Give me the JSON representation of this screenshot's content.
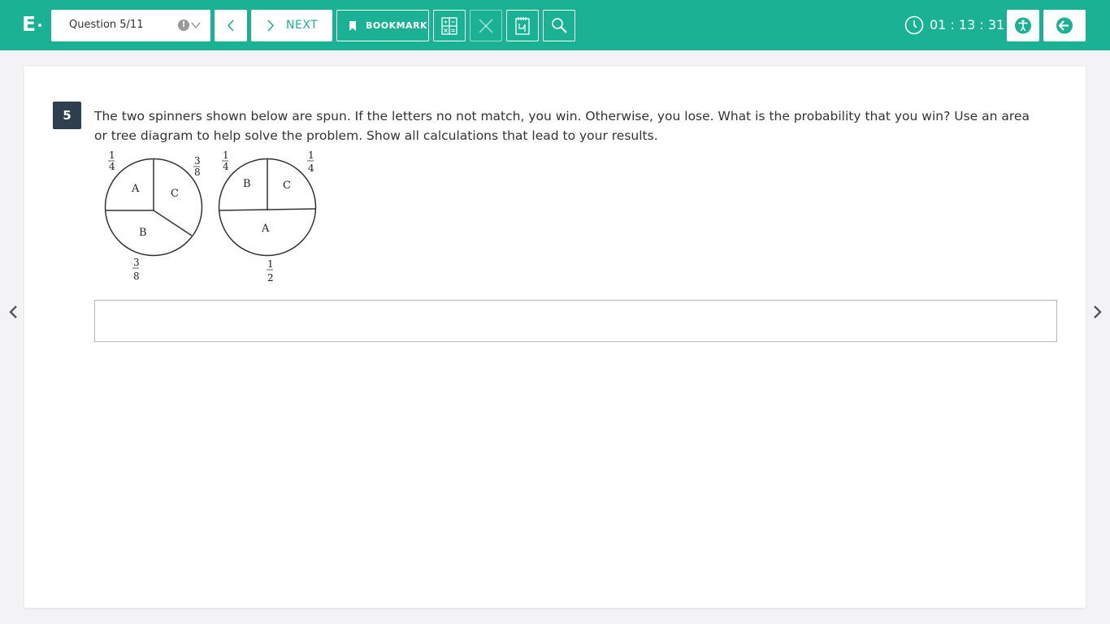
{
  "logo": {
    "text": "E"
  },
  "question_selector": {
    "label": "Question 5/11",
    "warning_symbol": "!"
  },
  "toolbar": {
    "next_label": "NEXT",
    "bookmark_label": "BOOKMARK",
    "tools": [
      "calculator-icon",
      "eliminate-icon",
      "scratchpad-icon",
      "zoom-icon"
    ]
  },
  "timer": {
    "value": "01 : 13 : 31"
  },
  "question": {
    "number": "5",
    "text": "The two spinners shown below are spun. If the letters no not match, you win. Otherwise, you lose. What is the probability that you win? Use an area or tree diagram to help solve the problem. Show all calculations that lead to your results."
  },
  "spinner_1": {
    "sections": [
      {
        "letter": "A",
        "fraction_num": "1",
        "fraction_den": "4"
      },
      {
        "letter": "C",
        "fraction_num": "3",
        "fraction_den": "8"
      },
      {
        "letter": "B",
        "fraction_num": "3",
        "fraction_den": "8"
      }
    ]
  },
  "spinner_2": {
    "sections": [
      {
        "letter": "B",
        "fraction_num": "1",
        "fraction_den": "4"
      },
      {
        "letter": "C",
        "fraction_num": "1",
        "fraction_den": "4"
      },
      {
        "letter": "A",
        "fraction_num": "1",
        "fraction_den": "2"
      }
    ]
  },
  "answer": {
    "value": ""
  },
  "colors": {
    "brand": "#1bb195",
    "question_badge": "#2e3f4f"
  }
}
